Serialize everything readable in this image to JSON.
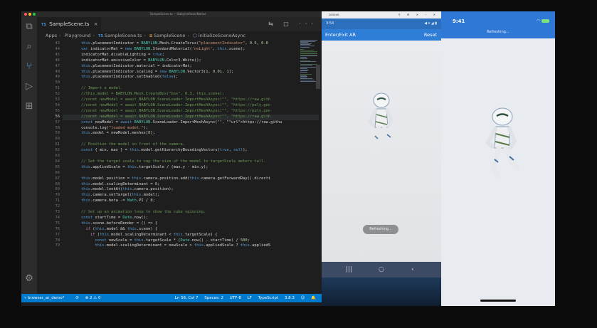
{
  "vscode": {
    "window_title": "SampleScene.ts — BabylonReactNative",
    "tab": {
      "badge": "TS",
      "label": "SampleScene.ts",
      "close": "×"
    },
    "tab_actions": "⇆ ▢ ···",
    "breadcrumb": [
      "Apps",
      "Playground",
      "SampleScene.ts",
      "SampleScene",
      "initializeSceneAsync"
    ],
    "breadcrumb_icons": [
      "ts-icon",
      "class-icon",
      "method-icon"
    ],
    "activity_icons": [
      "files-icon",
      "search-icon",
      "source-control-icon",
      "run-debug-icon",
      "extensions-icon",
      "settings-gear-icon"
    ],
    "line_numbers": [
      43,
      44,
      45,
      46,
      47,
      48,
      49,
      50,
      51,
      52,
      53,
      54,
      55,
      56,
      57,
      58,
      59,
      60,
      61,
      62,
      63,
      64,
      65,
      66,
      67,
      68,
      69,
      70,
      71,
      72,
      73,
      74,
      75,
      76,
      77,
      78,
      79
    ],
    "current_line": 56,
    "code_lines": [
      "        this.placementIndicator = BABYLON.Mesh.CreateTorus(\"placementIndicator\", 0.5, 0.0",
      "        var indicatorMat = new BABYLON.StandardMaterial('noLight', this.scene);",
      "        indicatorMat.disableLighting = true;",
      "        indicatorMat.emissiveColor = BABYLON.Color3.White();",
      "        this.placementIndicator.material = indicatorMat;",
      "        this.placementIndicator.scaling = new BABYLON.Vector3(1, 0.01, 1);",
      "        this.placementIndicator.setEnabled(false);",
      "",
      "        // Import a model.",
      "        //this.model = BABYLON.Mesh.CreateBox(\"box\", 0.3, this.scene);",
      "        //const newModel = await BABYLON.SceneLoader.ImportMeshAsync(\"\", \"https://raw.gith",
      "        //const newModel = await BABYLON.SceneLoader.ImportMeshAsync(\"\", \"https://poly.goo",
      "        //const newModel = await BABYLON.SceneLoader.ImportMeshAsync(\"\", \"https://poly.goo",
      "        //const newModel = await BABYLON.SceneLoader.ImportMeshAsync(\"\", \"https://raw.gith",
      "        const newModel = await BABYLON.SceneLoader.ImportMeshAsync(\"\", \"https://raw.githu",
      "        console.log(\"loaded model.\");",
      "        this.model = newModel.meshes[0];",
      "",
      "        // Position the model in front of the camera.",
      "        const { min, max } = this.model.getHierarchyBoundingVectors(true, null);",
      "",
      "        // Set the target scale to cap the size of the model to targetScale meters tall.",
      "        this.appliedScale = this.targetScale / (max.y - min.y);",
      "",
      "        this.model.position = this.camera.position.add(this.camera.getForwardRay().directi",
      "        this.model.scalingDeterminant = 0;",
      "        this.model.lookAt(this.camera.position);",
      "        this.camera.setTarget(this.model);",
      "        this.camera.beta -= Math.PI / 8;",
      "",
      "        // Set up an animation loop to show the cube spinning.",
      "        const startTime = Date.now();",
      "        this.scene.beforeRender = () => {",
      "          if (this.model && this.scene) {",
      "            if (this.model.scalingDeterminant < this.targetScale) {",
      "              const newScale = this.targetScale * (Date.now() - startTime) / 500;",
      "              this.model.scalingDeterminant = newScale > this.appliedScale ? this.appliedS"
    ],
    "status": {
      "branch": "browser_ar_demo*",
      "sync": "⟳",
      "problems": "⊗ 2 ⚠ 0",
      "position": "Ln 56, Col 7",
      "spaces": "Spaces: 2",
      "encoding": "UTF-8",
      "eol": "LF",
      "language": "TypeScript",
      "version": "3.8.3",
      "feedback": "☺",
      "bell": "🔔"
    }
  },
  "android": {
    "emulator_title": "Lenovo",
    "emulator_controls": "⚲ ⚙ ✕ – ✕",
    "status_time": "3:54",
    "status_right": "◀ ▾ ◢ ▮",
    "appbar_left": "Enter/Exit AR",
    "appbar_right": "Reset",
    "toast": "Refreshing...",
    "nav": [
      "|||",
      "○",
      "‹"
    ]
  },
  "ios": {
    "time": "9:41",
    "status_right": "wifi",
    "title": "Refreshing..."
  }
}
